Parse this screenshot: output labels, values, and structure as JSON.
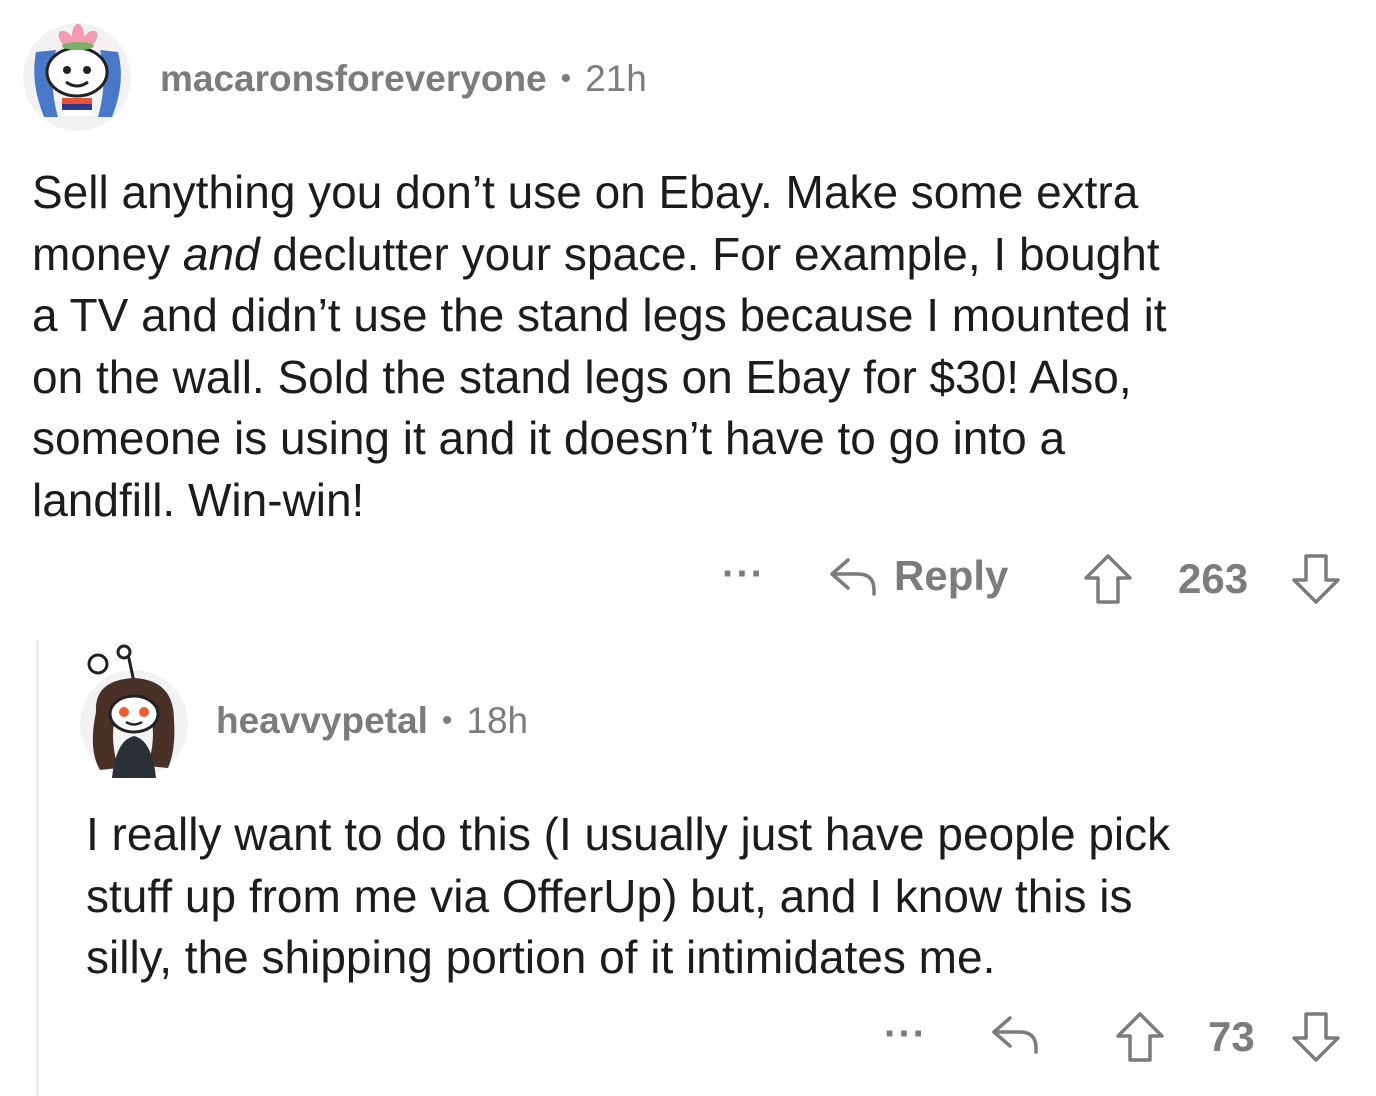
{
  "comment": {
    "username": "macaronsforeveryone",
    "separator": "•",
    "age": "21h",
    "body_lines": [
      {
        "pre": "Sell anything you don’t use on Ebay. Make some extra",
        "em": "",
        "post": ""
      },
      {
        "pre": "money ",
        "em": "and",
        "post": " declutter your space. For example, I bought"
      },
      {
        "pre": "a TV and didn’t use the stand legs because I mounted it",
        "em": "",
        "post": ""
      },
      {
        "pre": "on the wall. Sold the stand legs on Ebay for $30! Also,",
        "em": "",
        "post": ""
      },
      {
        "pre": "someone is using it and it doesn’t have to go into a",
        "em": "",
        "post": ""
      },
      {
        "pre": "landfill. Win-win!",
        "em": "",
        "post": ""
      }
    ],
    "more_label": "···",
    "reply_label": "Reply",
    "score": "263",
    "icons": {
      "reply": "reply-arrow-icon",
      "upvote": "upvote-arrow-icon",
      "downvote": "downvote-arrow-icon"
    }
  },
  "reply": {
    "username": "heavvypetal",
    "separator": "•",
    "age": "18h",
    "body_lines": [
      "I really want to do this (I usually just have people pick",
      "stuff up from me via OfferUp) but, and I know this is",
      "silly, the shipping portion of it intimidates me."
    ],
    "more_label": "···",
    "score": "73",
    "icons": {
      "reply": "reply-arrow-icon",
      "upvote": "upvote-arrow-icon",
      "downvote": "downvote-arrow-icon"
    }
  },
  "colors": {
    "text": "#1c1c1c",
    "meta": "#7c7c7c",
    "thread_line": "#ededed",
    "background": "#ffffff"
  }
}
